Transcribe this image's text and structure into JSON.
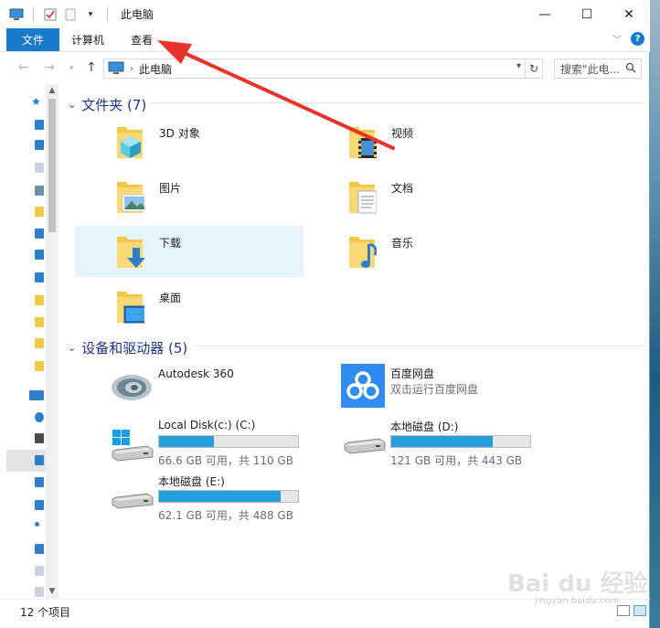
{
  "window": {
    "title": "此电脑",
    "controls": {
      "minimize": "—",
      "maximize": "☐",
      "close": "✕"
    }
  },
  "ribbon": {
    "file_tab": "文件",
    "tabs": [
      "计算机",
      "查看"
    ]
  },
  "address": {
    "path": "此电脑",
    "search_placeholder": "搜索\"此电..."
  },
  "folders_section": {
    "title": "文件夹 (7)",
    "items": [
      {
        "label": "3D 对象",
        "icon": "3d-objects-icon"
      },
      {
        "label": "视频",
        "icon": "video-icon"
      },
      {
        "label": "图片",
        "icon": "pictures-icon"
      },
      {
        "label": "文档",
        "icon": "documents-icon"
      },
      {
        "label": "下载",
        "icon": "downloads-icon",
        "selected": true
      },
      {
        "label": "音乐",
        "icon": "music-icon"
      },
      {
        "label": "桌面",
        "icon": "desktop-icon"
      }
    ]
  },
  "devices_section": {
    "title": "设备和驱动器 (5)",
    "items": [
      {
        "name": "Autodesk 360",
        "subtitle": "",
        "icon": "autodesk-360-icon"
      },
      {
        "name": "百度网盘",
        "subtitle": "双击运行百度网盘",
        "icon": "baidu-netdisk-icon"
      },
      {
        "name": "Local Disk(c:) (C:)",
        "free_text": "66.6 GB 可用，共 110 GB",
        "used_fraction": 0.395,
        "icon": "windows-drive-icon"
      },
      {
        "name": "本地磁盘 (D:)",
        "free_text": "121 GB 可用，共 443 GB",
        "used_fraction": 0.727,
        "icon": "drive-icon"
      },
      {
        "name": "本地磁盘 (E:)",
        "free_text": "62.1 GB 可用，共 488 GB",
        "used_fraction": 0.873,
        "icon": "drive-icon"
      }
    ]
  },
  "status": {
    "item_count": "12 个项目"
  },
  "watermark": {
    "main": "Bai du 经验",
    "sub": "jingyan.baidu.com"
  },
  "colors": {
    "accent": "#1979ca",
    "bar_fill": "#26a0da",
    "section_title": "#1e3287",
    "selection": "#e5f3fb",
    "annotation": "#e8332b"
  }
}
